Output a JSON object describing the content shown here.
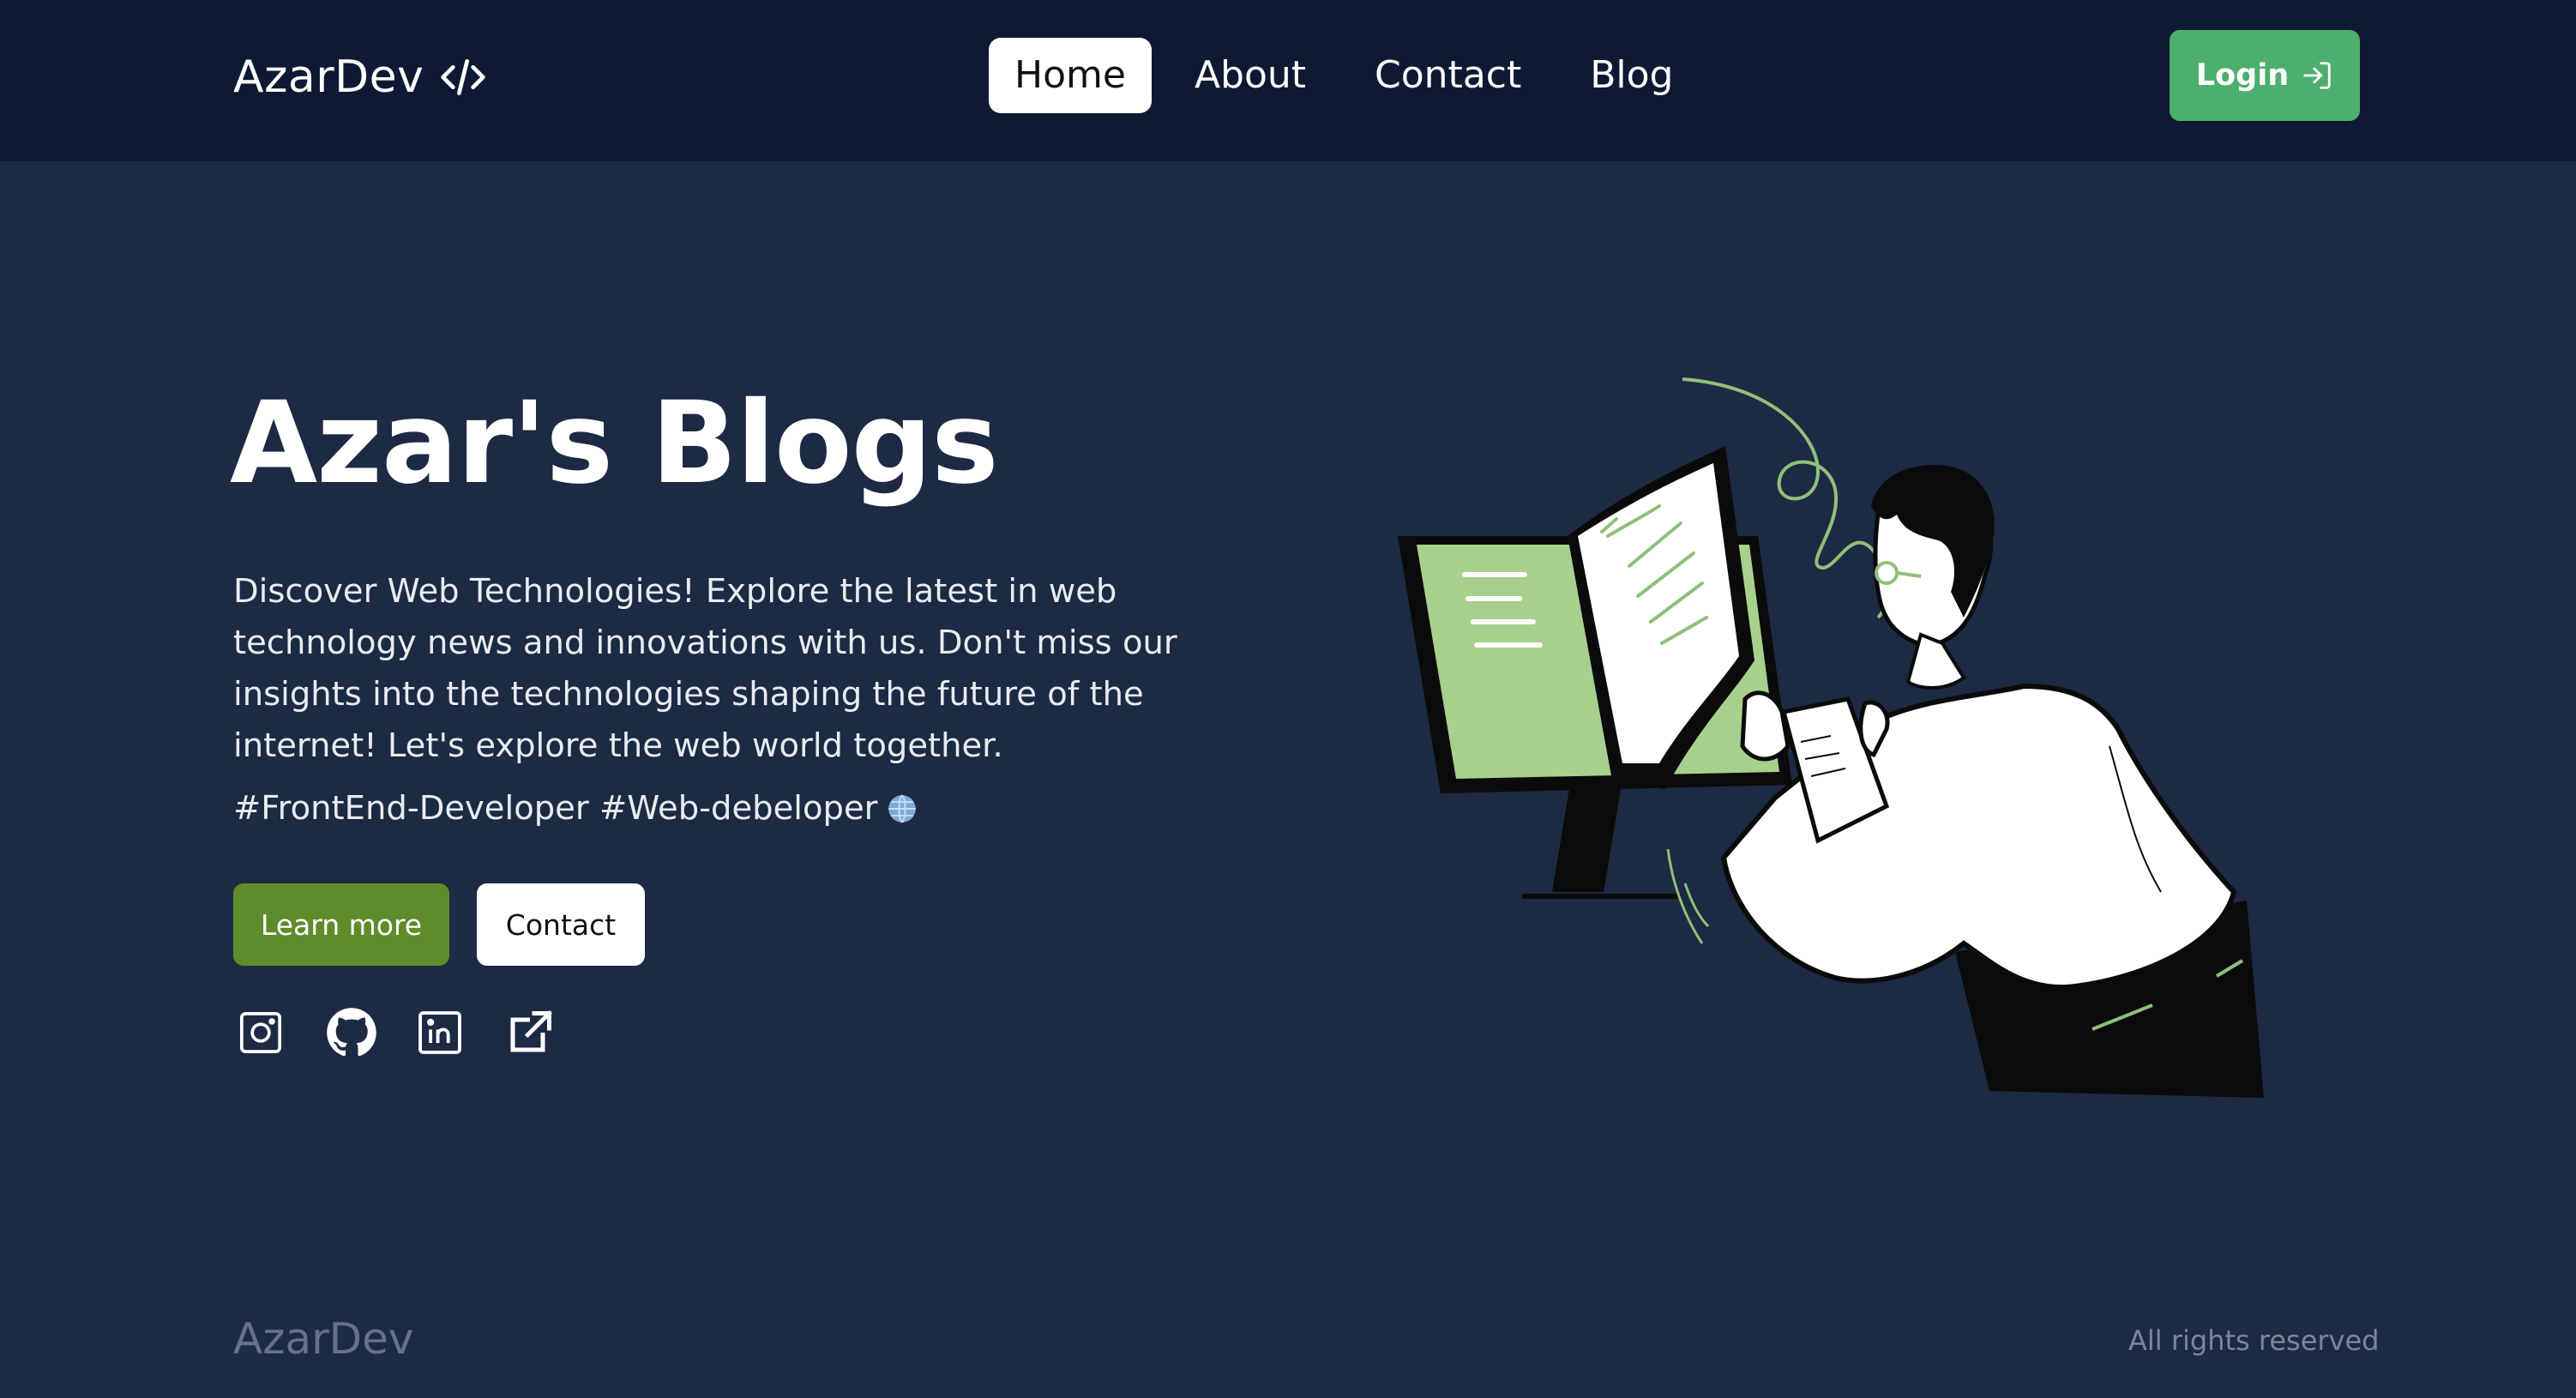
{
  "header": {
    "brand": "AzarDev",
    "brand_icon": "code-icon",
    "nav": [
      "Home",
      "About",
      "Contact",
      "Blog"
    ],
    "active": "Home",
    "login_label": "Login",
    "login_icon": "login-icon"
  },
  "hero": {
    "title": "Azar's Blogs",
    "description": "Discover Web Technologies! Explore the latest in web technology news and innovations with us. Don't miss our insights into the technologies shaping the future of the internet! Let's explore the web world together.",
    "hashtags": "#FrontEnd-Developer #Web-debeloper",
    "hashtag_icon": "globe-icon",
    "learn_more": "Learn more",
    "contact": "Contact",
    "socials": [
      "instagram-icon",
      "github-icon",
      "linkedin-icon",
      "external-link-icon"
    ]
  },
  "footer": {
    "brand": "AzarDev",
    "rights": "All rights reserved"
  },
  "colors": {
    "page_bg": "#1c2a43",
    "nav_bg": "#0e1a33",
    "login_green": "#4caf6d",
    "learn_more_green": "#5e8c2a",
    "accent_green": "#a8d08d"
  }
}
